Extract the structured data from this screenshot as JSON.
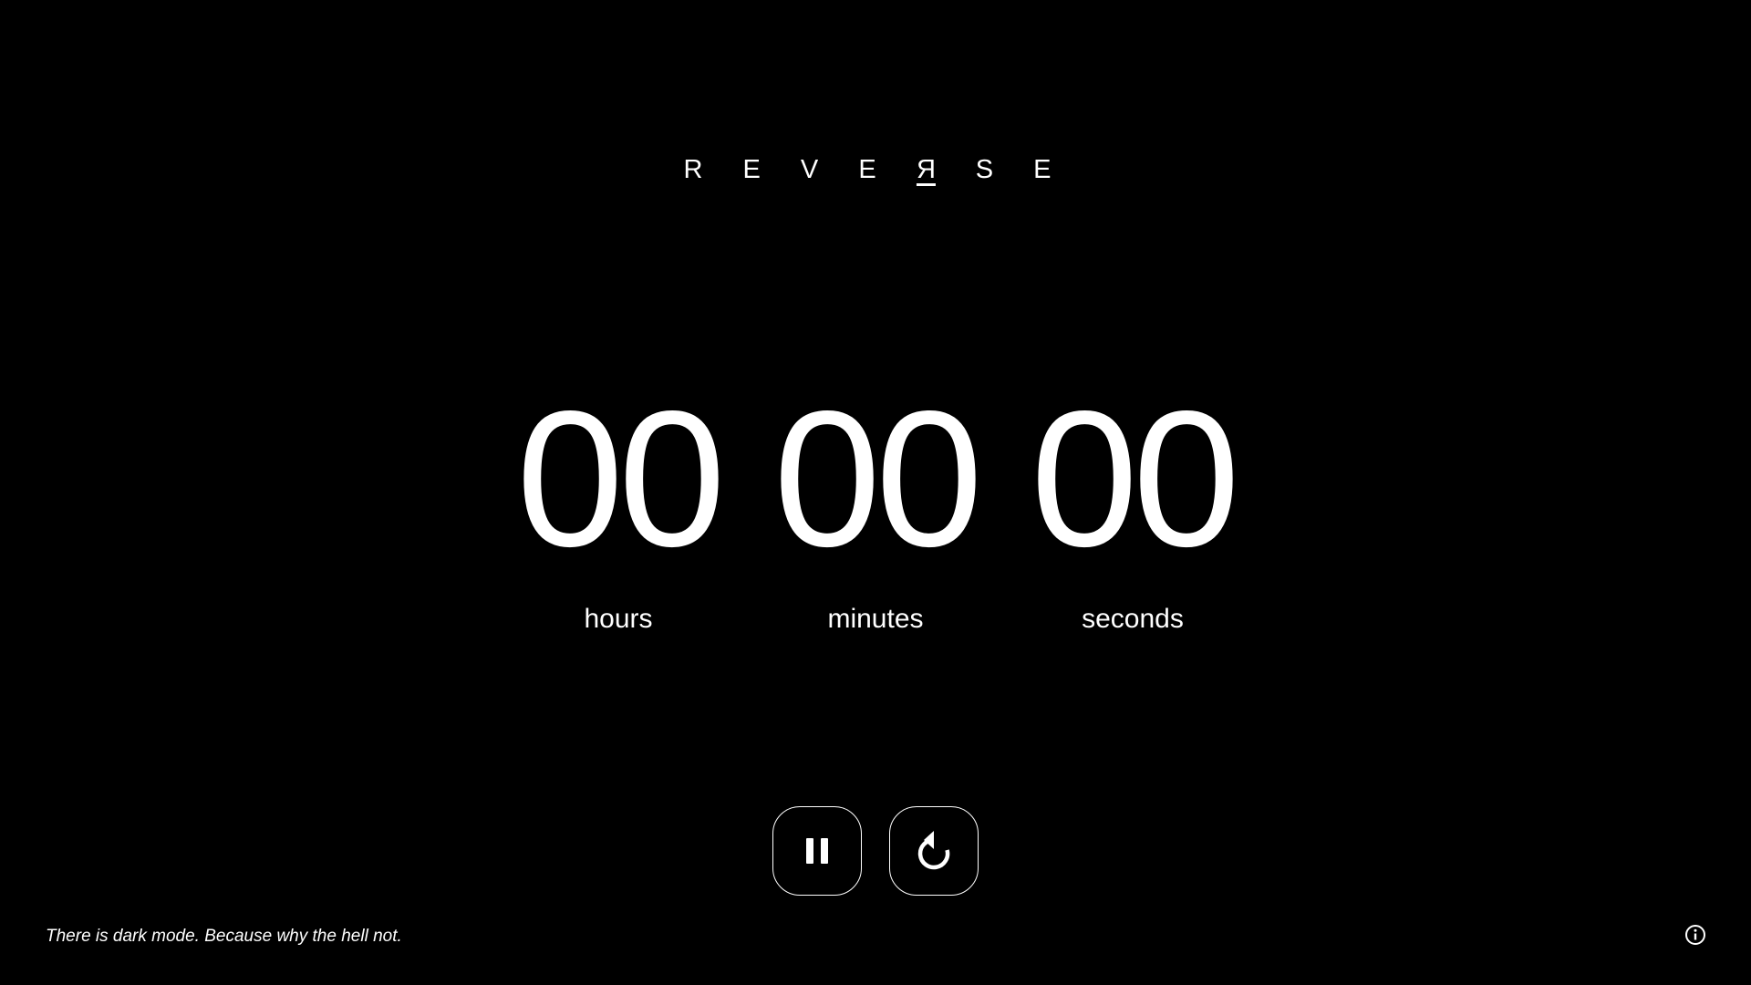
{
  "app": {
    "logo_letters": [
      "R",
      "E",
      "V",
      "E"
    ],
    "logo_reversed_letter": "R",
    "logo_tail_letters": [
      "S",
      "E"
    ]
  },
  "timer": {
    "hours": {
      "value": "00",
      "label": "hours"
    },
    "minutes": {
      "value": "00",
      "label": "minutes"
    },
    "seconds": {
      "value": "00",
      "label": "seconds"
    }
  },
  "controls": {
    "pause_icon": "pause-icon",
    "reset_icon": "reset-icon"
  },
  "footer": {
    "tagline": "There is dark mode. Because why the hell not.",
    "info_icon": "info-icon"
  },
  "colors": {
    "background": "#000000",
    "foreground": "#ffffff"
  }
}
